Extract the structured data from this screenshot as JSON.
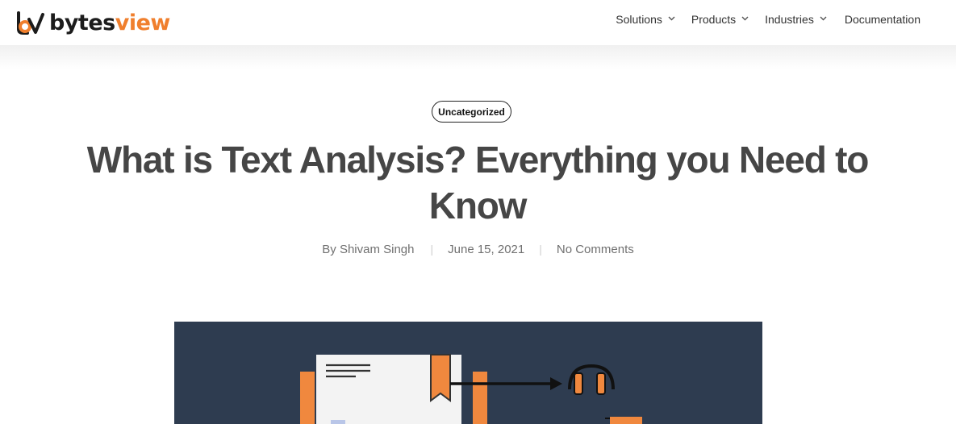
{
  "brand": {
    "name_part1": "bytes",
    "name_part2": "view",
    "accent_color": "#f07f2d",
    "dark_color": "#1c1c1c"
  },
  "nav": {
    "items": [
      {
        "label": "Solutions",
        "icon": "chevron-down-icon"
      },
      {
        "label": "Products",
        "icon": "chevron-down-icon"
      },
      {
        "label": "Industries",
        "icon": "chevron-down-icon"
      }
    ],
    "documentation": "Documentation"
  },
  "post": {
    "category": "Uncategorized",
    "title": "What is Text Analysis? Everything you Need to Know",
    "author": "By Shivam Singh",
    "date": "June 15, 2021",
    "comments": "No Comments"
  },
  "hero": {
    "background_color": "#2e3c50",
    "illustration": "document-to-headphones-illustration"
  }
}
